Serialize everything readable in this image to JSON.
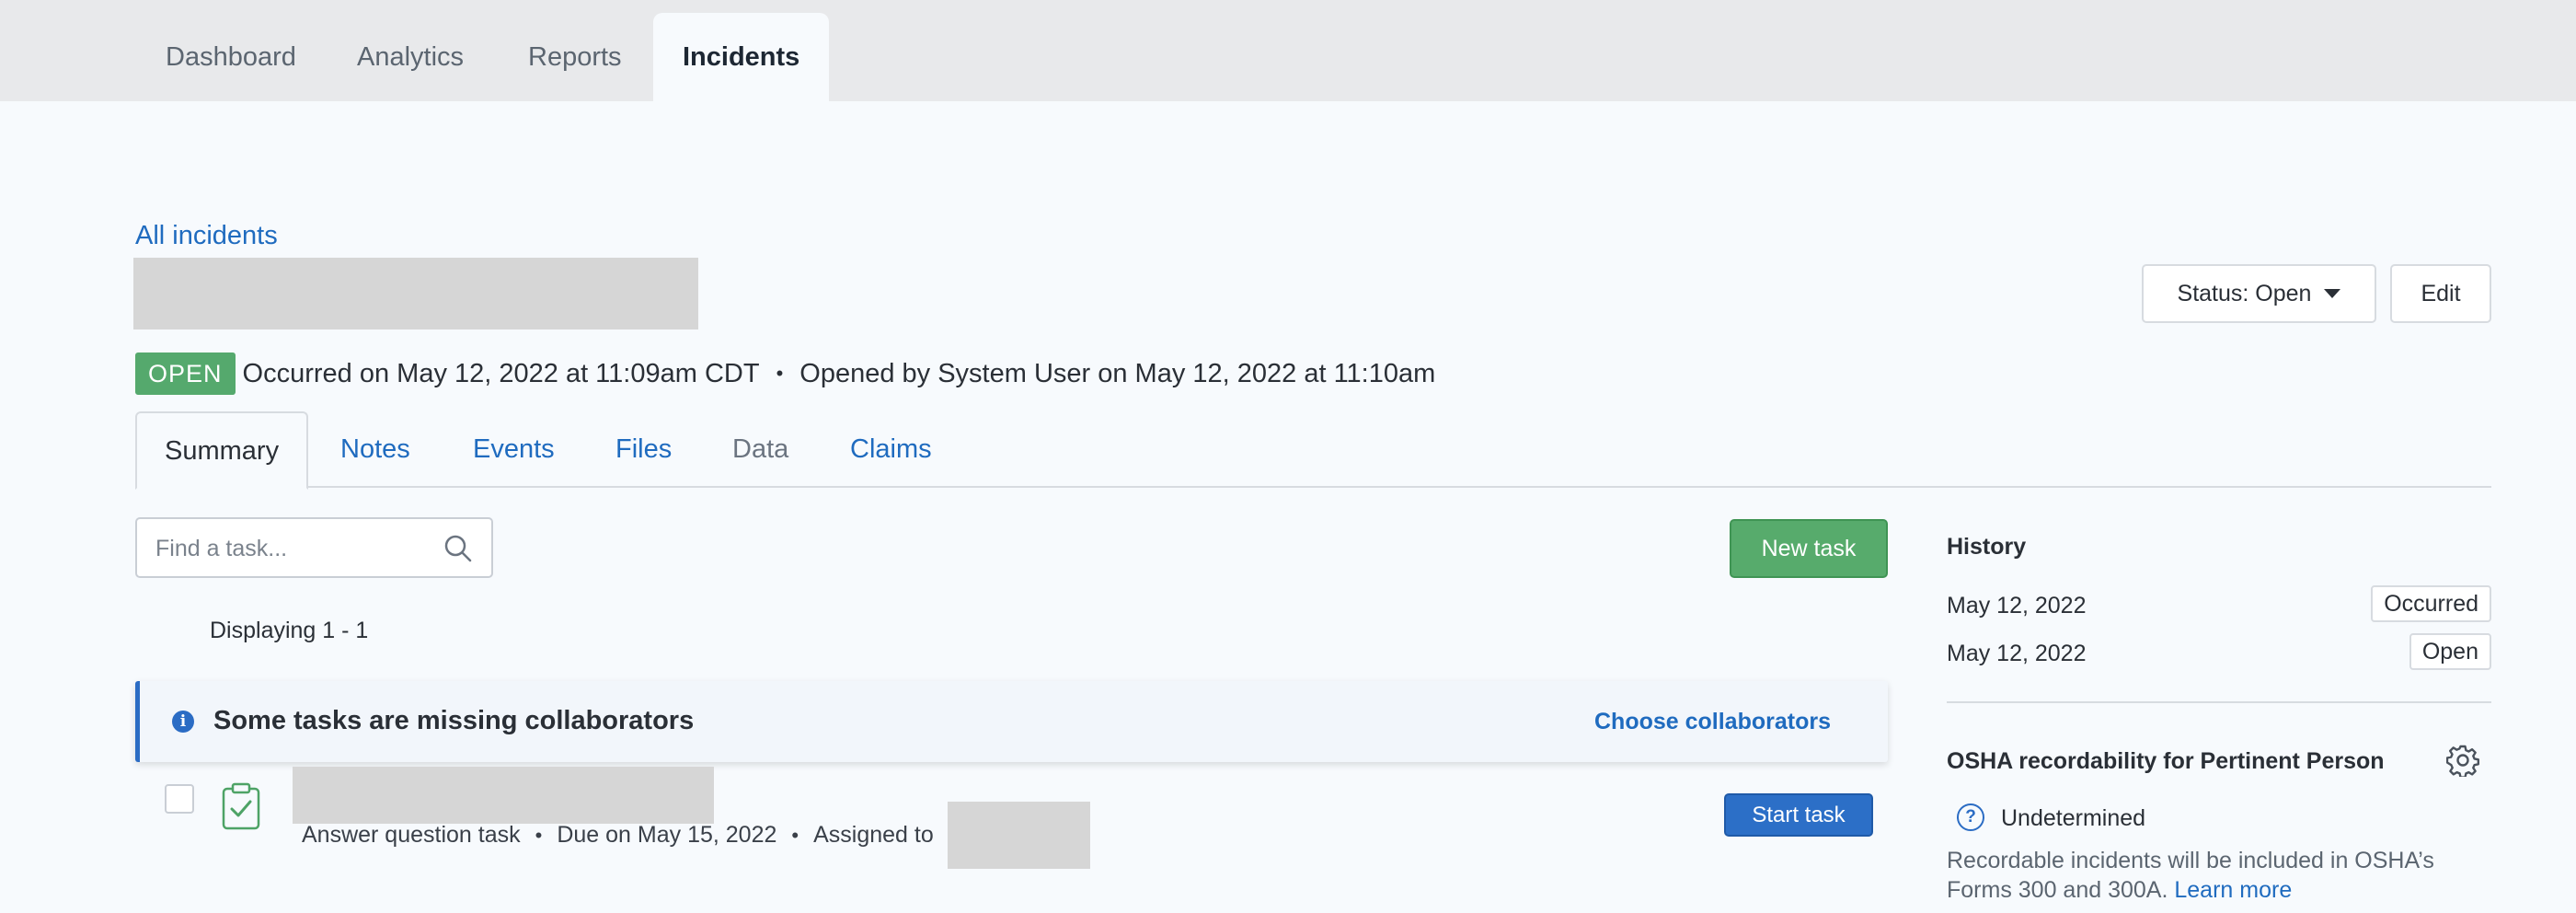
{
  "topnav": {
    "tabs": [
      {
        "label": "Dashboard"
      },
      {
        "label": "Analytics"
      },
      {
        "label": "Reports"
      },
      {
        "label": "Incidents",
        "active": true
      }
    ]
  },
  "header": {
    "back_link": "All incidents",
    "status_button": "Status: Open",
    "edit_button": "Edit"
  },
  "meta": {
    "badge": "OPEN",
    "occurred": "Occurred on May 12, 2022 at 11:09am CDT",
    "separator": "•",
    "opened": "Opened by System User on May 12, 2022 at 11:10am"
  },
  "subtabs": [
    {
      "label": "Summary",
      "state": "active"
    },
    {
      "label": "Notes",
      "state": "link"
    },
    {
      "label": "Events",
      "state": "link"
    },
    {
      "label": "Files",
      "state": "link"
    },
    {
      "label": "Data",
      "state": "disabled"
    },
    {
      "label": "Claims",
      "state": "link"
    }
  ],
  "tasks": {
    "search_placeholder": "Find a task...",
    "new_task_button": "New task",
    "displaying": "Displaying 1 - 1",
    "alert_text": "Some tasks are missing collaborators",
    "alert_link": "Choose collaborators",
    "items": [
      {
        "type": "Answer question task",
        "due": "Due on May 15, 2022",
        "assigned_label": "Assigned to",
        "action": "Start task"
      }
    ]
  },
  "history": {
    "title": "History",
    "rows": [
      {
        "date": "May 12, 2022",
        "badge": "Occurred"
      },
      {
        "date": "May 12, 2022",
        "badge": "Open"
      }
    ]
  },
  "osha": {
    "title": "OSHA recordability for Pertinent Person",
    "status": "Undetermined",
    "description": "Recordable incidents will be included in OSHA’s Forms 300 and 300A.",
    "learn_more": "Learn more"
  },
  "colors": {
    "link": "#1f6bbf",
    "open_badge": "#55a96d",
    "new_task": "#57ab6c",
    "start_task": "#2c6fc7",
    "alert_border": "#2b6cc4"
  },
  "icons": [
    "search-icon",
    "info-icon",
    "clipboard-check-icon",
    "gear-icon",
    "question-icon",
    "caret-down-icon"
  ]
}
